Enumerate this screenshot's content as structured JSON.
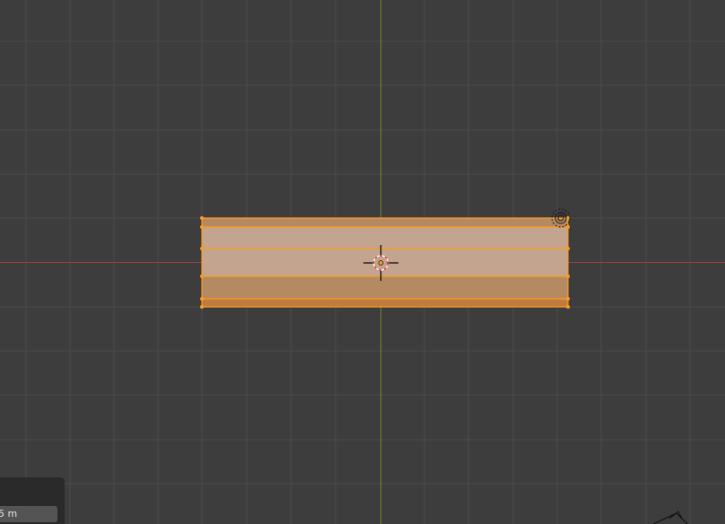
{
  "viewport": {
    "background": "#3d3d3d",
    "grid_color": "#4a4a4a",
    "x_axis_color": "#9c3e4a",
    "y_axis_color": "#6e8a2c",
    "selection_color": "#ff9a1f"
  },
  "operator_panel": {
    "value": "5 m"
  },
  "icons": {
    "cursor": "3d-cursor-icon",
    "light": "light-object-icon",
    "origin": "object-origin-icon",
    "camera": "camera-object-icon"
  }
}
